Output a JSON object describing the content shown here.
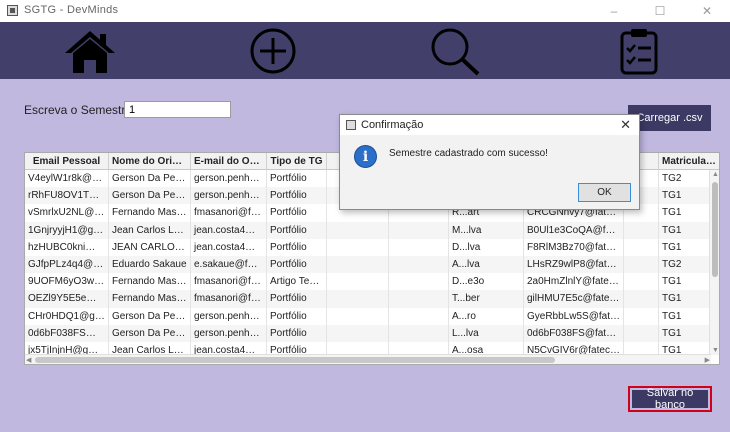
{
  "window": {
    "title": "SGTG - DevMinds",
    "controls": [
      "–",
      "☐",
      "✕"
    ]
  },
  "nav": {
    "icons": [
      "home-icon",
      "add-circle-icon",
      "search-icon",
      "clipboard-icon"
    ]
  },
  "semester": {
    "label": "Escreva o Semestre",
    "value": "1"
  },
  "buttons": {
    "load_csv": "Carregar .csv",
    "save_db": "Salvar no banco"
  },
  "table": {
    "columns": [
      "Email Pessoal",
      "Nome do Orienta...",
      "E-mail do Orien...",
      "Tipo de TG",
      "",
      "",
      "",
      "",
      "",
      "Matriculado"
    ],
    "rows": [
      [
        "V4eylW1r8k@gmai...",
        "Gerson Da Penha ...",
        "gerson.penha@f...",
        "Portfólio",
        "",
        "",
        "",
        "",
        "",
        "TG2"
      ],
      [
        "rRhFU8OV1T@hot...",
        "Gerson Da Penha ...",
        "gerson.penha@f...",
        "Portfólio",
        "",
        "",
        "",
        "",
        "",
        "TG1"
      ],
      [
        "vSmrlxU2NL@gma...",
        "Fernando Masano ...",
        "fmasanori@fate...",
        "Portfólio",
        "",
        "",
        "R...art",
        "CRCGNnvy7@fatec.s...",
        "",
        "TG1"
      ],
      [
        "1GnjryyjH1@gmail...",
        "Jean Carlos Loure...",
        "jean.costa4@fat...",
        "Portfólio",
        "",
        "",
        "M...lva",
        "B0Ul1e3CoQA@fatec.s...",
        "",
        "TG1"
      ],
      [
        "hzHUBC0kni@gmo...",
        "JEAN CARLOS LO...",
        "jean.costa4@fat...",
        "Portfólio",
        "",
        "",
        "D...lva",
        "F8RlM3Bz70@fatec.s...",
        "",
        "TG1"
      ],
      [
        "GJfpPLz4q4@gmai...",
        "Eduardo Sakaue",
        "e.sakaue@fatec...",
        "Portfólio",
        "",
        "",
        "A...lva",
        "LHsRZ9wlP8@fatec.s...",
        "",
        "TG2"
      ],
      [
        "9UOFM6yO3w@g...",
        "Fernando Masano ...",
        "fmasanori@fate...",
        "Artigo Tecno...",
        "",
        "",
        "D...e3o",
        "2a0HmZlnlY@fatec.s...",
        "",
        "TG1"
      ],
      [
        "OEZl9Y5E5e@gma...",
        "Fernando Masano ...",
        "fmasanori@fate...",
        "Portfólio",
        "",
        "",
        "T...ber",
        "gilHMU7E5c@fatec.s...",
        "",
        "TG1"
      ],
      [
        "CHr0HDQ1@gmail...",
        "Gerson Da Penha ...",
        "gerson.penha@f...",
        "Portfólio",
        "",
        "",
        "A...ro",
        "GyeRbbLw5S@fatec.s...",
        "",
        "TG1"
      ],
      [
        "0d6bF038FS@fate...",
        "Gerson Da Penha ...",
        "gerson.penha@f...",
        "Portfólio",
        "",
        "",
        "L...lva",
        "0d6bF038FS@fatec.s...",
        "",
        "TG1"
      ],
      [
        "jx5TjInjnH@gmail...",
        "Jean Carlos Loure...",
        "jean.costa4@fat...",
        "Portfólio",
        "",
        "",
        "A...osa",
        "N5CvGIV6r@fatec.sp...",
        "",
        "TG1"
      ]
    ]
  },
  "dialog": {
    "title": "Confirmação",
    "message": "Semestre cadastrado com sucesso!",
    "ok": "OK",
    "close": "✕",
    "icon": "info-icon"
  },
  "colors": {
    "background": "#c1b8e0",
    "navbar": "#42406a",
    "button": "#3c3a64",
    "highlight": "#d0021b",
    "info": "#2b6fc8"
  }
}
